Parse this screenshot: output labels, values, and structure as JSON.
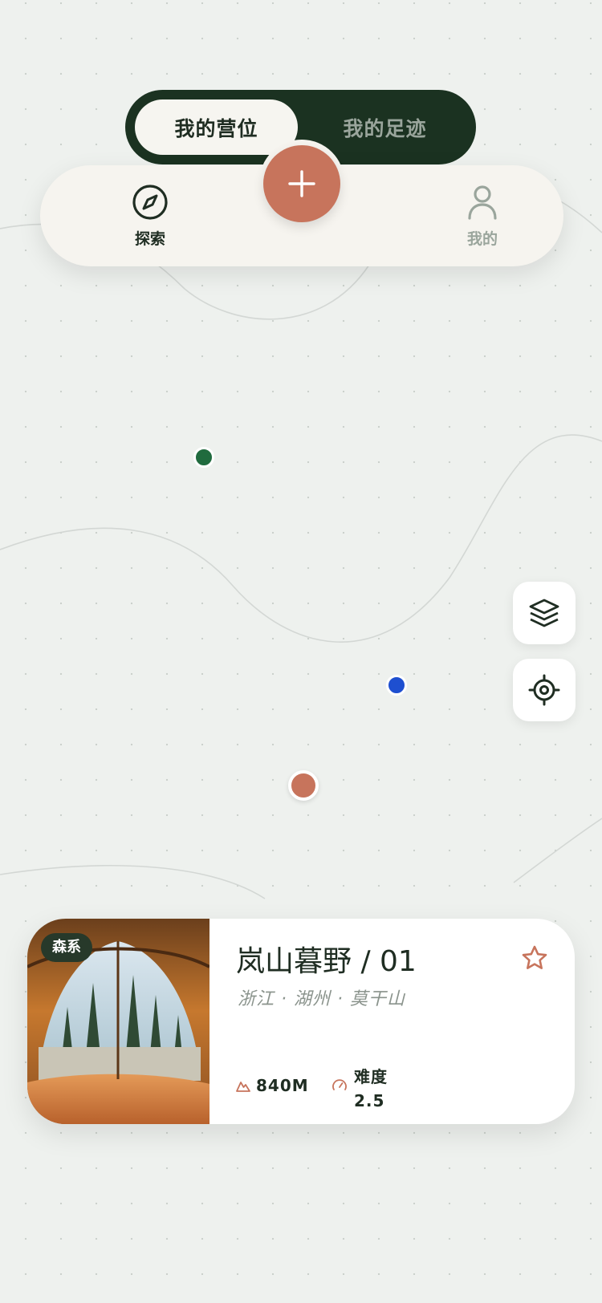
{
  "segmented_control": {
    "tabs": [
      {
        "label": "我的营位",
        "active": true
      },
      {
        "label": "我的足迹",
        "active": false
      }
    ]
  },
  "nav": {
    "explore_label": "探索",
    "explore_icon": "compass-icon",
    "add_icon": "plus-icon",
    "mine_label": "我的",
    "mine_icon": "user-icon"
  },
  "map": {
    "controls": [
      {
        "icon": "layers-icon"
      },
      {
        "icon": "locate-icon"
      }
    ],
    "pins": [
      {
        "color": "#206b3e"
      },
      {
        "color": "#1e4fd0"
      },
      {
        "color": "#c7745c"
      }
    ]
  },
  "place_card": {
    "tag": "森系",
    "title": "岚山暮野 / 01",
    "location": "浙江 · 湖州 · 莫干山",
    "altitude": "840M",
    "difficulty": "难度 2.5",
    "favorite_icon": "star-icon"
  },
  "colors": {
    "accent": "#c7745c",
    "dark_green": "#1b3221",
    "background": "#eef1ee"
  }
}
